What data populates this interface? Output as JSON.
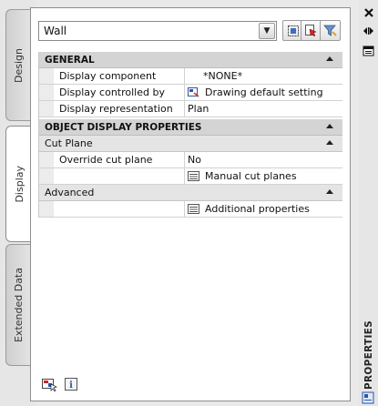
{
  "tabs": [
    {
      "label": "Design",
      "active": false
    },
    {
      "label": "Display",
      "active": true
    },
    {
      "label": "Extended Data",
      "active": false
    }
  ],
  "header": {
    "style_value": "Wall"
  },
  "general": {
    "title": "GENERAL",
    "rows": [
      {
        "name": "Display component",
        "value": "*NONE*"
      },
      {
        "name": "Display controlled by",
        "value": "Drawing default setting"
      },
      {
        "name": "Display representation",
        "value": "Plan"
      }
    ]
  },
  "object_display": {
    "title": "OBJECT DISPLAY PROPERTIES",
    "cut_plane": {
      "title": "Cut Plane",
      "rows": [
        {
          "name": "Override cut plane",
          "value": "No"
        },
        {
          "name": "",
          "value": "Manual cut planes"
        }
      ]
    },
    "advanced": {
      "title": "Advanced",
      "rows": [
        {
          "name": "",
          "value": "Additional properties"
        }
      ]
    }
  },
  "palette": {
    "label": "PROPERTIES"
  },
  "colors": {
    "category_bg": "#d4d4d4",
    "subcategory_bg": "#e4e4e4",
    "panel_bg": "#ffffff",
    "chrome_bg": "#e6e6e6"
  }
}
